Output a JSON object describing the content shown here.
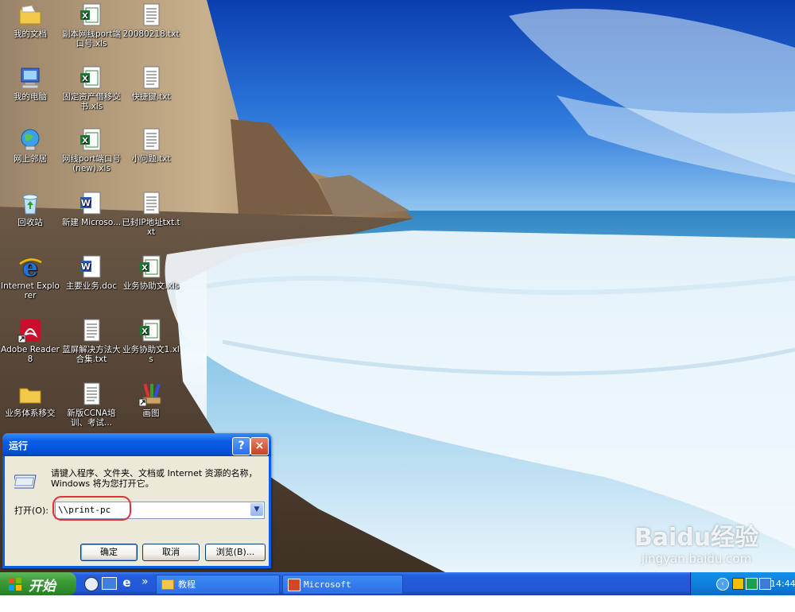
{
  "desktop": {
    "icons": [
      {
        "label": "我的文档"
      },
      {
        "label": "副本网线port端口号.xls"
      },
      {
        "label": "20080218.txt"
      },
      {
        "label": "我的电脑"
      },
      {
        "label": "固定资产借移交书.xls"
      },
      {
        "label": "快捷键.txt"
      },
      {
        "label": "网上邻居"
      },
      {
        "label": "网线port端口号(new).xls"
      },
      {
        "label": "小问题.txt"
      },
      {
        "label": "回收站"
      },
      {
        "label": "新建 Microso..."
      },
      {
        "label": "已封IP地址txt.txt"
      },
      {
        "label": "Internet Explorer"
      },
      {
        "label": "主要业务.doc"
      },
      {
        "label": "业务协助文.xls"
      },
      {
        "label": "Adobe Reader 8"
      },
      {
        "label": "蓝屏解决方法大合集.txt"
      },
      {
        "label": "业务协助文1.xls"
      },
      {
        "label": "业务体系移交"
      },
      {
        "label": "新版CCNA培训、考试..."
      },
      {
        "label": "画图"
      }
    ],
    "watermark": {
      "brand": "Baidu经验",
      "url": "jingyan.baidu.com"
    }
  },
  "run_dialog": {
    "title": "运行",
    "help_button": "?",
    "close_button": "×",
    "description": "请键入程序、文件夹、文档或 Internet 资源的名称，Windows 将为您打开它。",
    "open_label": "打开(O):",
    "open_value": "\\\\print-pc",
    "ok_label": "确定",
    "cancel_label": "取消",
    "browse_label": "浏览(B)...",
    "highlight_color": "#e0303a"
  },
  "taskbar": {
    "start_label": "开始",
    "more_chevron": "»",
    "tasks": [
      {
        "label": "教程"
      },
      {
        "label": "Microsoft PowerP..."
      }
    ],
    "clock": "14:44"
  }
}
